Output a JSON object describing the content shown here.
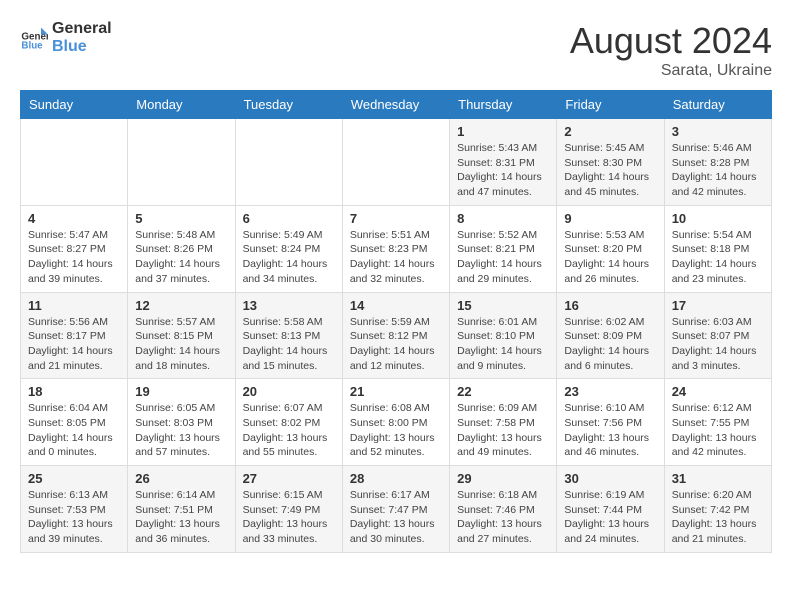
{
  "logo": {
    "line1": "General",
    "line2": "Blue"
  },
  "title": "August 2024",
  "location": "Sarata, Ukraine",
  "weekdays": [
    "Sunday",
    "Monday",
    "Tuesday",
    "Wednesday",
    "Thursday",
    "Friday",
    "Saturday"
  ],
  "weeks": [
    [
      {
        "day": "",
        "info": ""
      },
      {
        "day": "",
        "info": ""
      },
      {
        "day": "",
        "info": ""
      },
      {
        "day": "",
        "info": ""
      },
      {
        "day": "1",
        "info": "Sunrise: 5:43 AM\nSunset: 8:31 PM\nDaylight: 14 hours\nand 47 minutes."
      },
      {
        "day": "2",
        "info": "Sunrise: 5:45 AM\nSunset: 8:30 PM\nDaylight: 14 hours\nand 45 minutes."
      },
      {
        "day": "3",
        "info": "Sunrise: 5:46 AM\nSunset: 8:28 PM\nDaylight: 14 hours\nand 42 minutes."
      }
    ],
    [
      {
        "day": "4",
        "info": "Sunrise: 5:47 AM\nSunset: 8:27 PM\nDaylight: 14 hours\nand 39 minutes."
      },
      {
        "day": "5",
        "info": "Sunrise: 5:48 AM\nSunset: 8:26 PM\nDaylight: 14 hours\nand 37 minutes."
      },
      {
        "day": "6",
        "info": "Sunrise: 5:49 AM\nSunset: 8:24 PM\nDaylight: 14 hours\nand 34 minutes."
      },
      {
        "day": "7",
        "info": "Sunrise: 5:51 AM\nSunset: 8:23 PM\nDaylight: 14 hours\nand 32 minutes."
      },
      {
        "day": "8",
        "info": "Sunrise: 5:52 AM\nSunset: 8:21 PM\nDaylight: 14 hours\nand 29 minutes."
      },
      {
        "day": "9",
        "info": "Sunrise: 5:53 AM\nSunset: 8:20 PM\nDaylight: 14 hours\nand 26 minutes."
      },
      {
        "day": "10",
        "info": "Sunrise: 5:54 AM\nSunset: 8:18 PM\nDaylight: 14 hours\nand 23 minutes."
      }
    ],
    [
      {
        "day": "11",
        "info": "Sunrise: 5:56 AM\nSunset: 8:17 PM\nDaylight: 14 hours\nand 21 minutes."
      },
      {
        "day": "12",
        "info": "Sunrise: 5:57 AM\nSunset: 8:15 PM\nDaylight: 14 hours\nand 18 minutes."
      },
      {
        "day": "13",
        "info": "Sunrise: 5:58 AM\nSunset: 8:13 PM\nDaylight: 14 hours\nand 15 minutes."
      },
      {
        "day": "14",
        "info": "Sunrise: 5:59 AM\nSunset: 8:12 PM\nDaylight: 14 hours\nand 12 minutes."
      },
      {
        "day": "15",
        "info": "Sunrise: 6:01 AM\nSunset: 8:10 PM\nDaylight: 14 hours\nand 9 minutes."
      },
      {
        "day": "16",
        "info": "Sunrise: 6:02 AM\nSunset: 8:09 PM\nDaylight: 14 hours\nand 6 minutes."
      },
      {
        "day": "17",
        "info": "Sunrise: 6:03 AM\nSunset: 8:07 PM\nDaylight: 14 hours\nand 3 minutes."
      }
    ],
    [
      {
        "day": "18",
        "info": "Sunrise: 6:04 AM\nSunset: 8:05 PM\nDaylight: 14 hours\nand 0 minutes."
      },
      {
        "day": "19",
        "info": "Sunrise: 6:05 AM\nSunset: 8:03 PM\nDaylight: 13 hours\nand 57 minutes."
      },
      {
        "day": "20",
        "info": "Sunrise: 6:07 AM\nSunset: 8:02 PM\nDaylight: 13 hours\nand 55 minutes."
      },
      {
        "day": "21",
        "info": "Sunrise: 6:08 AM\nSunset: 8:00 PM\nDaylight: 13 hours\nand 52 minutes."
      },
      {
        "day": "22",
        "info": "Sunrise: 6:09 AM\nSunset: 7:58 PM\nDaylight: 13 hours\nand 49 minutes."
      },
      {
        "day": "23",
        "info": "Sunrise: 6:10 AM\nSunset: 7:56 PM\nDaylight: 13 hours\nand 46 minutes."
      },
      {
        "day": "24",
        "info": "Sunrise: 6:12 AM\nSunset: 7:55 PM\nDaylight: 13 hours\nand 42 minutes."
      }
    ],
    [
      {
        "day": "25",
        "info": "Sunrise: 6:13 AM\nSunset: 7:53 PM\nDaylight: 13 hours\nand 39 minutes."
      },
      {
        "day": "26",
        "info": "Sunrise: 6:14 AM\nSunset: 7:51 PM\nDaylight: 13 hours\nand 36 minutes."
      },
      {
        "day": "27",
        "info": "Sunrise: 6:15 AM\nSunset: 7:49 PM\nDaylight: 13 hours\nand 33 minutes."
      },
      {
        "day": "28",
        "info": "Sunrise: 6:17 AM\nSunset: 7:47 PM\nDaylight: 13 hours\nand 30 minutes."
      },
      {
        "day": "29",
        "info": "Sunrise: 6:18 AM\nSunset: 7:46 PM\nDaylight: 13 hours\nand 27 minutes."
      },
      {
        "day": "30",
        "info": "Sunrise: 6:19 AM\nSunset: 7:44 PM\nDaylight: 13 hours\nand 24 minutes."
      },
      {
        "day": "31",
        "info": "Sunrise: 6:20 AM\nSunset: 7:42 PM\nDaylight: 13 hours\nand 21 minutes."
      }
    ]
  ]
}
